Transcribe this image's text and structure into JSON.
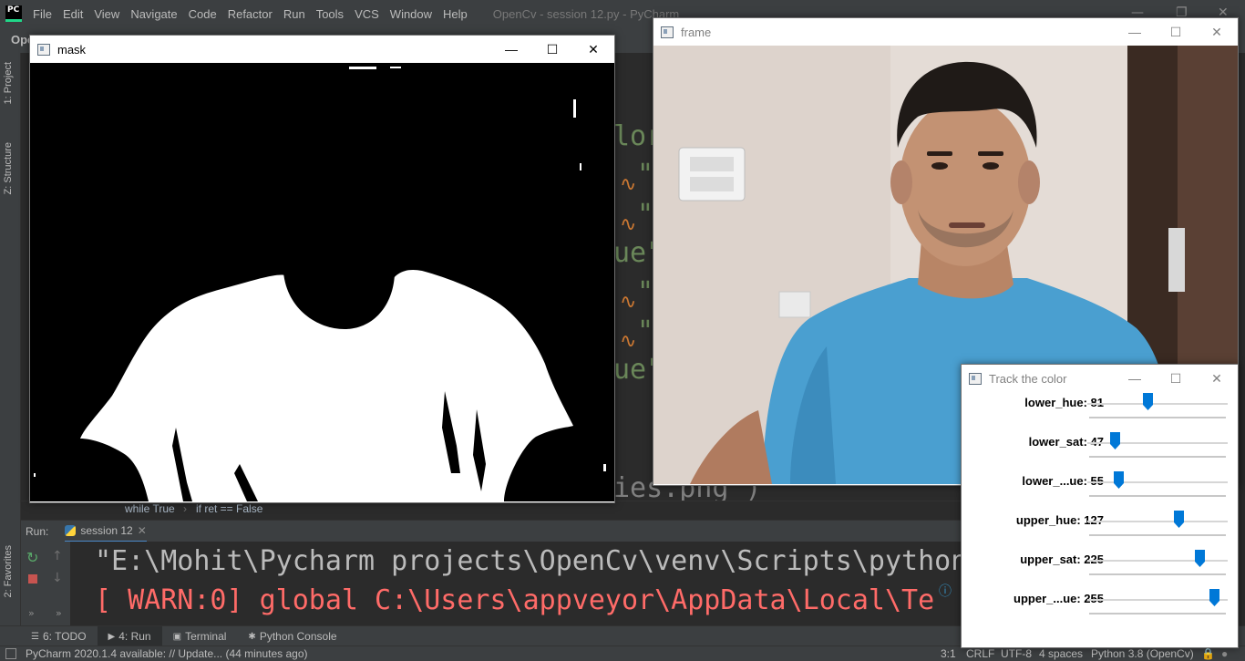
{
  "ide": {
    "logo": "PC",
    "menu": [
      "File",
      "Edit",
      "View",
      "Navigate",
      "Code",
      "Refactor",
      "Run",
      "Tools",
      "VCS",
      "Window",
      "Help"
    ],
    "title": "OpenCv - session 12.py - PyCharm",
    "project_crumb": "Ope",
    "left_tabs": [
      "1: Project",
      "Z: Structure",
      "2: Favorites"
    ],
    "editor_fragments": {
      "line1": "lor",
      "quote": "\"",
      "line_ue_a": "ue\"",
      "line_ue_b": "ue\"",
      "bottom": "ies.png')"
    },
    "breadcrumbs": [
      "while True",
      "if ret == False"
    ],
    "run": {
      "label": "Run:",
      "tab": "session 12",
      "lines": [
        "\"E:\\Mohit\\Pycharm projects\\OpenCv\\venv\\Scripts\\python",
        "[ WARN:0] global C:\\Users\\appveyor\\AppData\\Local\\Te"
      ]
    },
    "bottom_tabs": [
      {
        "num": "6",
        "label": "6: TODO"
      },
      {
        "num": "4",
        "label": "4: Run"
      },
      {
        "label": "Terminal"
      },
      {
        "label": "Python Console"
      }
    ],
    "status": {
      "message": "PyCharm 2020.1.4 available: // Update... (44 minutes ago)",
      "position": "3:1",
      "line_sep": "CRLF",
      "encoding": "UTF-8",
      "indent": "4 spaces",
      "interpreter": "Python 3.8 (OpenCv)"
    }
  },
  "windows": {
    "mask": {
      "title": "mask"
    },
    "frame": {
      "title": "frame"
    },
    "track": {
      "title": "Track the color",
      "trackbars": [
        {
          "label": "lower_hue: 81",
          "value": 81,
          "max": 179
        },
        {
          "label": "lower_sat: 47",
          "value": 47,
          "max": 255
        },
        {
          "label": "lower_...ue: 55",
          "value": 55,
          "max": 255
        },
        {
          "label": "upper_hue: 127",
          "value": 127,
          "max": 179
        },
        {
          "label": "upper_sat: 225",
          "value": 225,
          "max": 255
        },
        {
          "label": "upper_...ue: 255",
          "value": 255,
          "max": 255
        }
      ]
    }
  },
  "colors": {
    "ide_bg": "#2b2b2b",
    "panel": "#3c3f41",
    "string_green": "#6a8759",
    "warn_red": "#ff6b68",
    "thumb_blue": "#0078d7"
  }
}
